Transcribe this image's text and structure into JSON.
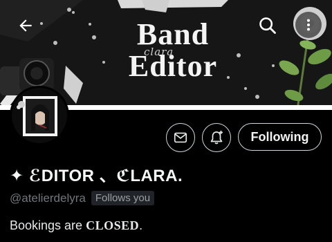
{
  "header": {
    "banner_title_line1": "Band",
    "banner_title_line2": "Editor",
    "banner_script": "clara",
    "back_icon": "arrow-left-icon",
    "search_icon": "search-icon",
    "more_icon": "more-vertical-icon"
  },
  "actions": {
    "message_icon": "mail-icon",
    "notify_icon": "bell-plus-icon",
    "follow_label": "Following"
  },
  "profile": {
    "display_name_symbol": "✦",
    "display_name_text": " ℰDITOR 、ℭLARA.",
    "handle": "@atelierdelyra",
    "follows_you": "Follows you",
    "bio_prefix": "Bookings are ",
    "bio_emphasis": "CLOSED",
    "bio_suffix": "."
  },
  "colors": {
    "background": "#000000",
    "text_primary": "#e7e9ea",
    "text_secondary": "#71767b",
    "button_border": "#cfd9de"
  }
}
